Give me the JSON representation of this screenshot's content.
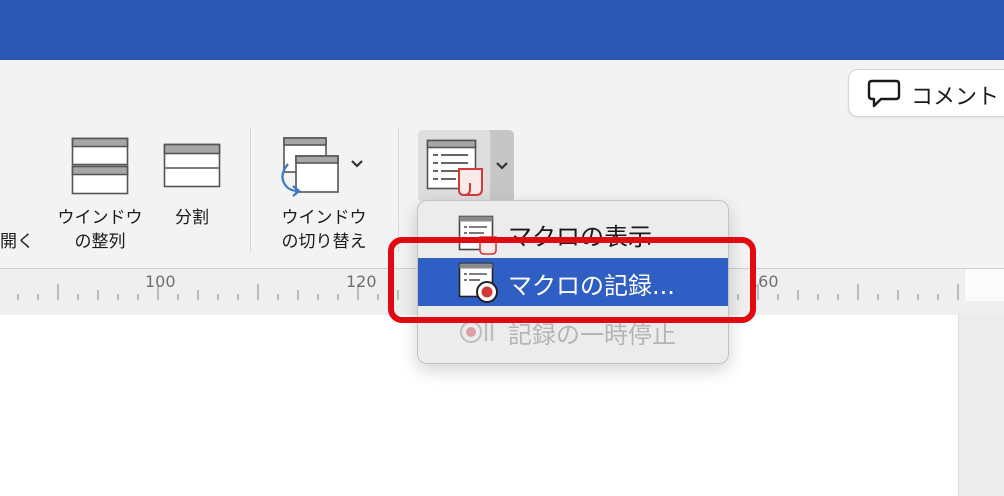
{
  "comment_button": {
    "label": "コメント",
    "icon": "speech-bubble-icon"
  },
  "ribbon": {
    "open_label": "開く",
    "arrange_window": {
      "line1": "ウインドウ",
      "line2": "の整列",
      "icon": "arrange-windows-icon"
    },
    "split": {
      "label": "分割",
      "icon": "split-window-icon"
    },
    "switch_window": {
      "line1": "ウインドウ",
      "line2": "の切り替え",
      "icon": "switch-windows-icon"
    },
    "macros": {
      "icon": "macros-icon"
    }
  },
  "ruler": {
    "labels": [
      "100",
      "120",
      "160"
    ]
  },
  "macro_menu": {
    "items": [
      {
        "label": "マクロの表示",
        "icon": "view-macros-icon",
        "state": "normal"
      },
      {
        "label": "マクロの記録...",
        "icon": "record-macro-icon",
        "state": "selected"
      },
      {
        "label": "記録の一時停止",
        "icon": "pause-record-icon",
        "state": "disabled"
      }
    ]
  },
  "colors": {
    "title_bar": "#2b56b3",
    "menu_selection": "#2f5fc5",
    "highlight_box": "#e20a12"
  }
}
